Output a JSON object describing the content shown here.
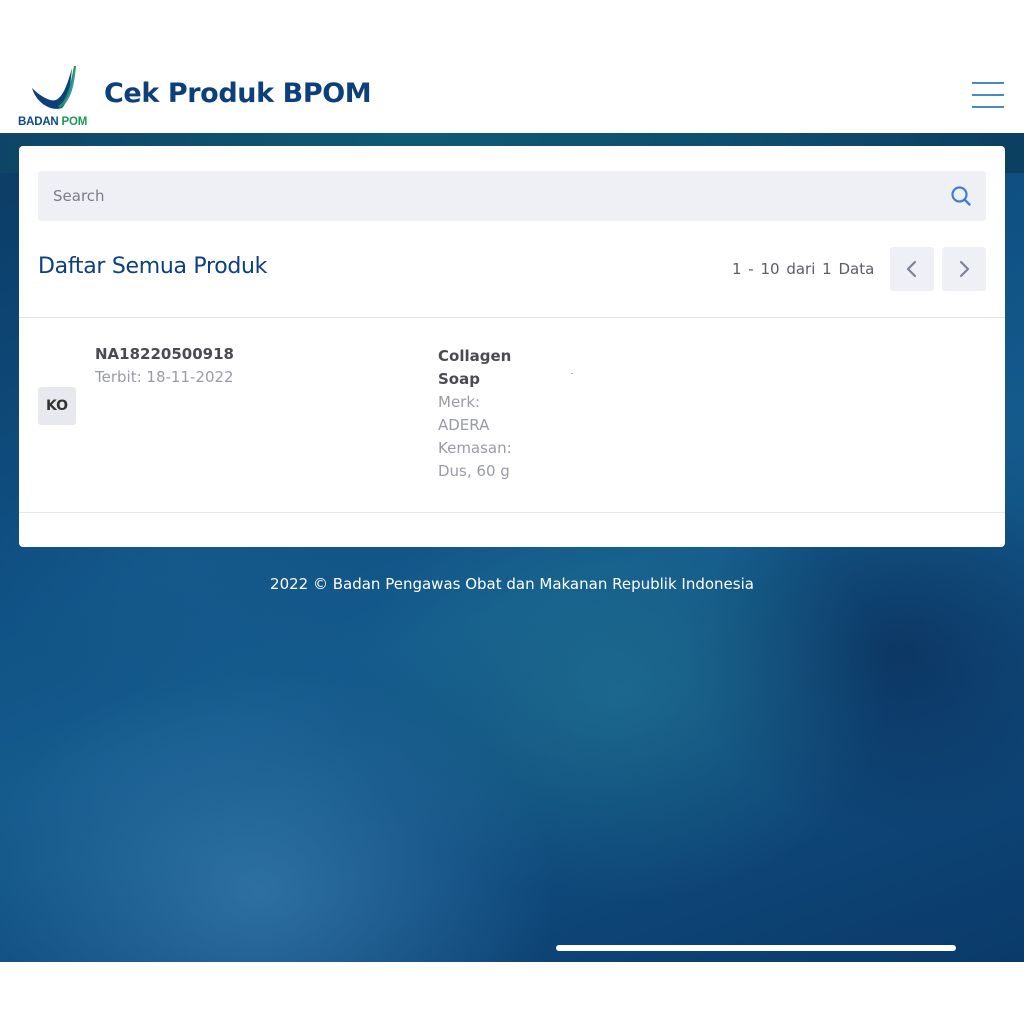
{
  "header": {
    "logo_text_main": "BADAN",
    "logo_text_accent": "POM",
    "title": "Cek Produk BPOM",
    "menu_icon": "hamburger-icon"
  },
  "search": {
    "placeholder": "Search",
    "value": "",
    "icon": "search-icon"
  },
  "list": {
    "title": "Daftar Semua Produk",
    "pagination_info": "1 - 10 dari 1 Data",
    "prev_icon": "chevron-left-icon",
    "next_icon": "chevron-right-icon"
  },
  "products": [
    {
      "category_badge": "KO",
      "registration_number": "NA18220500918",
      "issued": "Terbit: 18-11-2022",
      "name": "Collagen Soap",
      "brand": "Merk: ADERA",
      "packaging": "Kemasan: Dus, 60 g"
    }
  ],
  "footer": {
    "text": "2022 ©  Badan Pengawas Obat dan Makanan Republik Indonesia"
  },
  "colors": {
    "primary": "#0d3f7c",
    "accent_green": "#1a9a55",
    "search_bg": "#eff0f5",
    "link_blue": "#4a86c8"
  }
}
